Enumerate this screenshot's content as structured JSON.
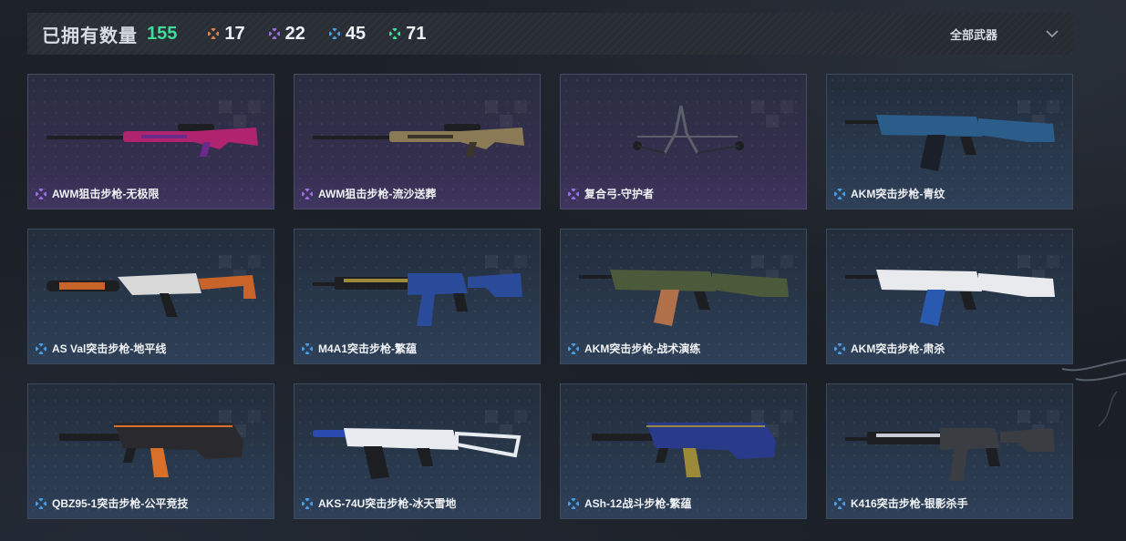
{
  "header": {
    "owned_label": "已拥有数量",
    "owned_count": "155",
    "owned_count_color": "#3ddc97",
    "stats": [
      {
        "icon": "orange-gem-icon",
        "color": "#d8834a",
        "value": "17"
      },
      {
        "icon": "purple-gem-icon",
        "color": "#9a6ee0",
        "value": "22"
      },
      {
        "icon": "blue-gem-icon",
        "color": "#4a9ae0",
        "value": "45"
      },
      {
        "icon": "green-gem-icon",
        "color": "#3ddc97",
        "value": "71"
      }
    ],
    "filter_label": "全部武器"
  },
  "colors": {
    "epic": "#9a6ee0",
    "rare": "#4a9ae0"
  },
  "cards": [
    {
      "name": "AWM狙击步枪-无极限",
      "rarity": "epic",
      "gun": "sniper",
      "body": "#b0246f",
      "accent": "#6a2a8a"
    },
    {
      "name": "AWM狙击步枪-流沙送葬",
      "rarity": "epic",
      "gun": "sniper",
      "body": "#8a7a56",
      "accent": "#3a342a"
    },
    {
      "name": "复合弓-守护者",
      "rarity": "epic",
      "gun": "bow",
      "body": "#5a5f6a",
      "accent": "#2a2d33"
    },
    {
      "name": "AKM突击步枪-青纹",
      "rarity": "rare",
      "gun": "ak",
      "body": "#2a5d8a",
      "accent": "#1a1f2a"
    },
    {
      "name": "AS Val突击步枪-地平线",
      "rarity": "rare",
      "gun": "asval",
      "body": "#c8642a",
      "accent": "#d8d8d8"
    },
    {
      "name": "M4A1突击步枪-繁蕴",
      "rarity": "rare",
      "gun": "m4",
      "body": "#2a4a9a",
      "accent": "#9a8a3a"
    },
    {
      "name": "AKM突击步枪-战术演练",
      "rarity": "rare",
      "gun": "ak",
      "body": "#4a5a3a",
      "accent": "#b0714a"
    },
    {
      "name": "AKM突击步枪-肃杀",
      "rarity": "rare",
      "gun": "ak",
      "body": "#e8eaee",
      "accent": "#2a5ab0"
    },
    {
      "name": "QBZ95-1突击步枪-公平竞技",
      "rarity": "rare",
      "gun": "bullpup",
      "body": "#2a2a2e",
      "accent": "#d8702a"
    },
    {
      "name": "AKS-74U突击步枪-冰天雪地",
      "rarity": "rare",
      "gun": "aks",
      "body": "#e8ecf0",
      "accent": "#2a4ab0"
    },
    {
      "name": "ASh-12战斗步枪-繁蕴",
      "rarity": "rare",
      "gun": "bullpup",
      "body": "#2a3a8a",
      "accent": "#9a8a3a"
    },
    {
      "name": "K416突击步枪-银影杀手",
      "rarity": "rare",
      "gun": "m4",
      "body": "#3a3d42",
      "accent": "#c8ccd2"
    }
  ]
}
